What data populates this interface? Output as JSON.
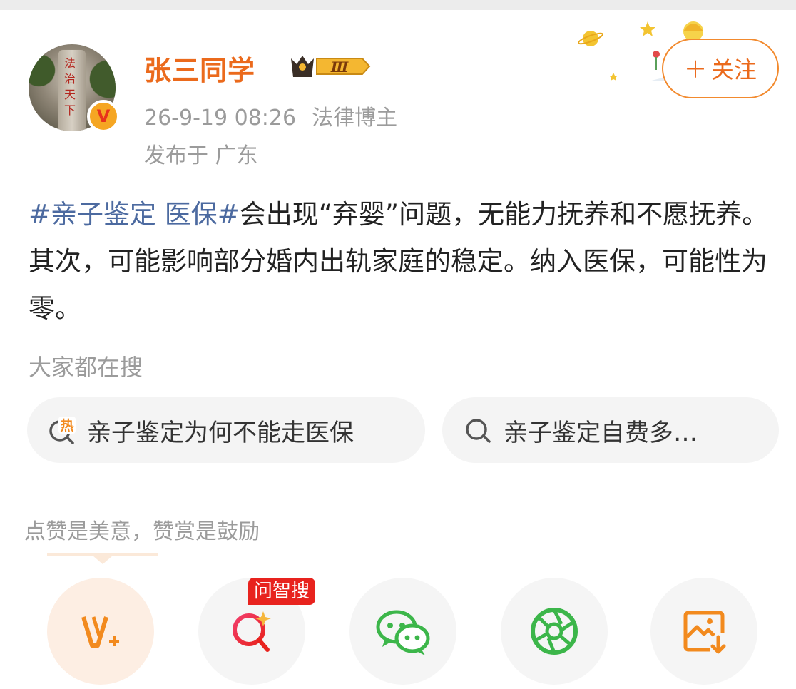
{
  "author": {
    "name": "张三同学",
    "level_badge": "Ⅲ",
    "verified_mark": "V",
    "avatar_text": "法治天下",
    "timestamp": "26-9-19 08:26",
    "title": "法律博主",
    "location": "发布于 广东"
  },
  "follow_button": {
    "plus": "+",
    "label": "关注"
  },
  "post": {
    "topic": "#亲子鉴定 医保#",
    "body": "会出现“弃婴”问题，无能力抚养和不愿抚养。其次，可能影响部分婚内出轨家庭的稳定。纳入医保，可能性为零。"
  },
  "search_section": {
    "title": "大家都在搜",
    "chips": [
      {
        "text": "亲子鉴定为何不能走医保",
        "icon": "hot-search-icon",
        "hot_label": "热"
      },
      {
        "text": "亲子鉴定自费多…",
        "icon": "search-icon"
      }
    ]
  },
  "reward_text": "点赞是美意，赞赏是鼓励",
  "actions": [
    {
      "name": "reward-v-plus",
      "icon": "v-plus-icon"
    },
    {
      "name": "ask-smart-search",
      "icon": "smart-search-icon",
      "tag": "问智搜"
    },
    {
      "name": "share-wechat",
      "icon": "wechat-icon"
    },
    {
      "name": "share-moments",
      "icon": "moments-icon"
    },
    {
      "name": "save-image",
      "icon": "save-image-icon"
    }
  ],
  "colors": {
    "accent_orange": "#eb6a1c",
    "topic_blue": "#4c6aa0",
    "gray_text": "#9b9b9b",
    "wechat_green": "#3cb64a",
    "ask_red": "#e8231e"
  }
}
